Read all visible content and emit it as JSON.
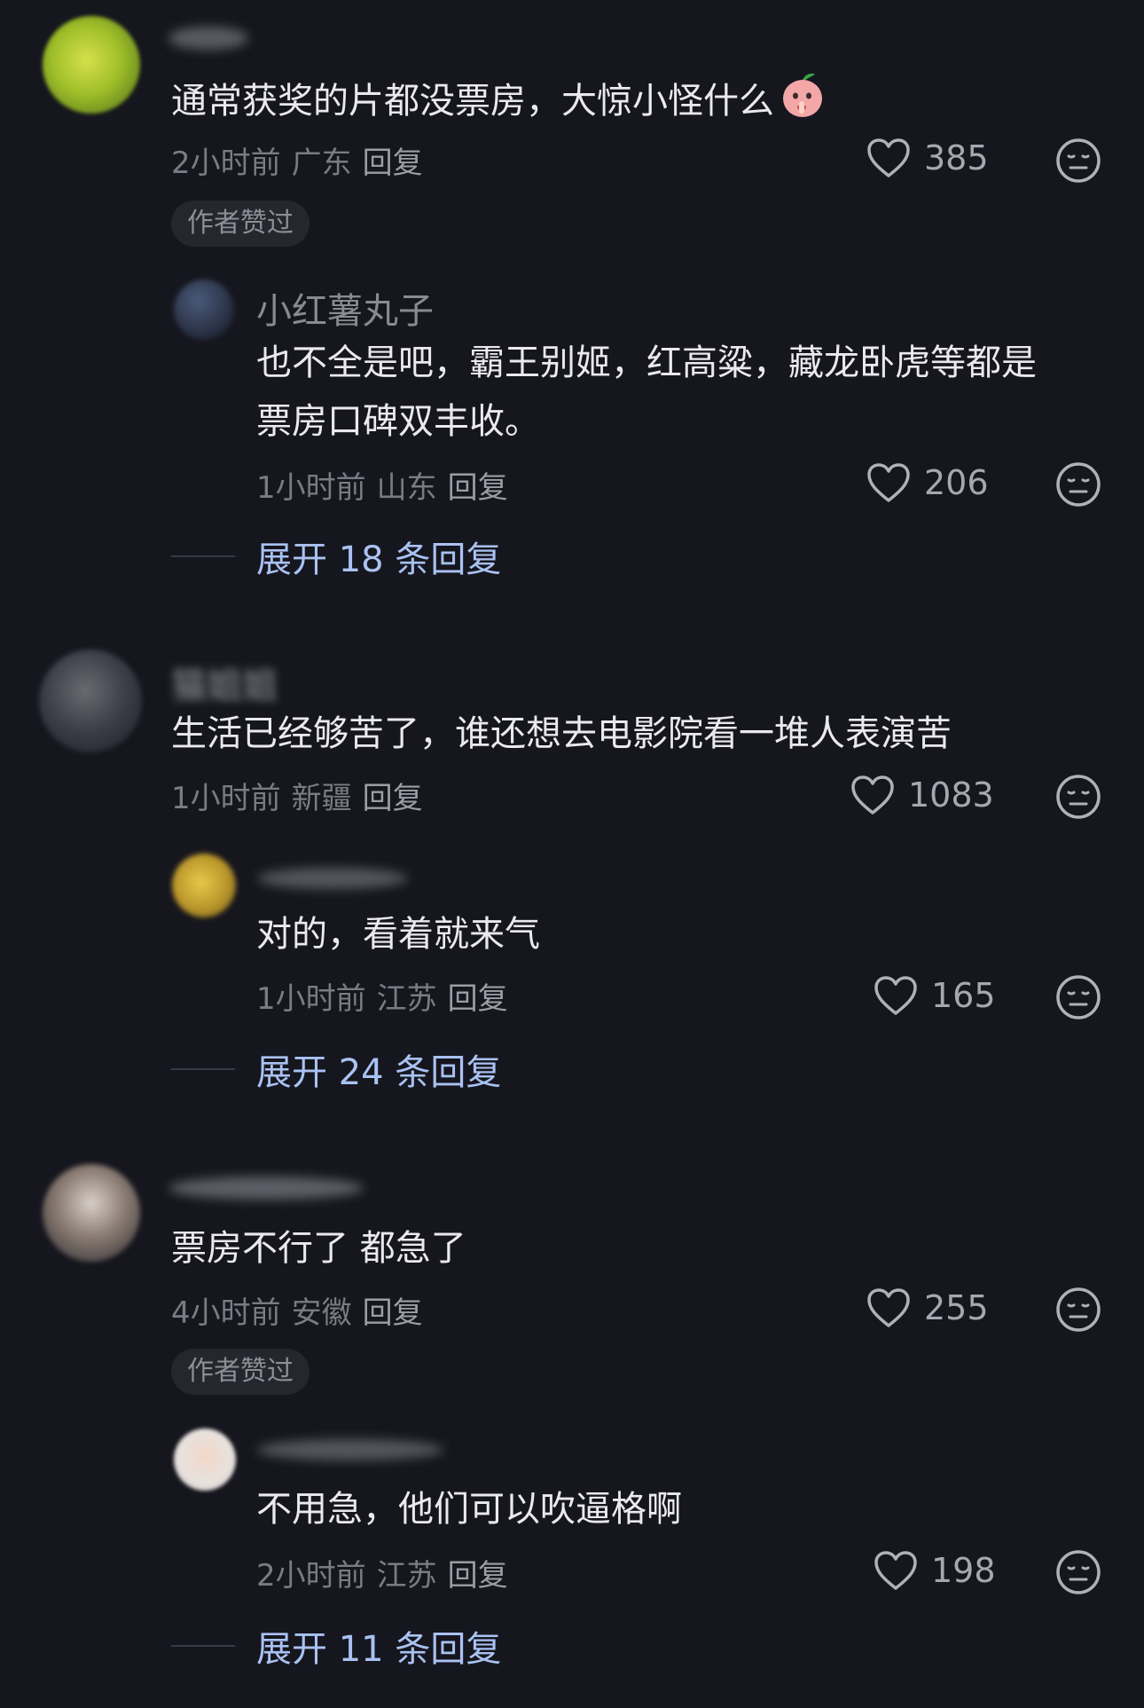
{
  "comments": [
    {
      "text": "通常获奖的片都没票房，大惊小怪什么",
      "time": "2小时前",
      "location": "广东",
      "reply_label": "回复",
      "likes": "385",
      "badge": "作者赞过",
      "reply": {
        "username": "小红薯丸子",
        "text_line1": "也不全是吧，霸王别姬，红高粱，藏龙卧虎等都是",
        "text_line2": "票房口碑双丰收。",
        "time": "1小时前",
        "location": "山东",
        "reply_label": "回复",
        "likes": "206"
      },
      "expand_label": "展开 18 条回复"
    },
    {
      "username": "猫姐姐",
      "text": "生活已经够苦了，谁还想去电影院看一堆人表演苦",
      "time": "1小时前",
      "location": "新疆",
      "reply_label": "回复",
      "likes": "1083",
      "reply": {
        "text": "对的，看着就来气",
        "time": "1小时前",
        "location": "江苏",
        "reply_label": "回复",
        "likes": "165"
      },
      "expand_label": "展开 24 条回复"
    },
    {
      "text": "票房不行了 都急了",
      "time": "4小时前",
      "location": "安徽",
      "reply_label": "回复",
      "likes": "255",
      "badge": "作者赞过",
      "reply": {
        "text": "不用急，他们可以吹逼格啊",
        "time": "2小时前",
        "location": "江苏",
        "reply_label": "回复",
        "likes": "198"
      },
      "expand_label": "展开 11 条回复"
    }
  ],
  "icons": {
    "like": "heart-outline-icon",
    "dislike": "neutral-face-icon",
    "emoji": "peach-shush-emoji"
  },
  "colors": {
    "background": "#16161e",
    "text": "#e9e9ee",
    "meta": "#7b7b84",
    "expand": "#a9c2f2"
  }
}
